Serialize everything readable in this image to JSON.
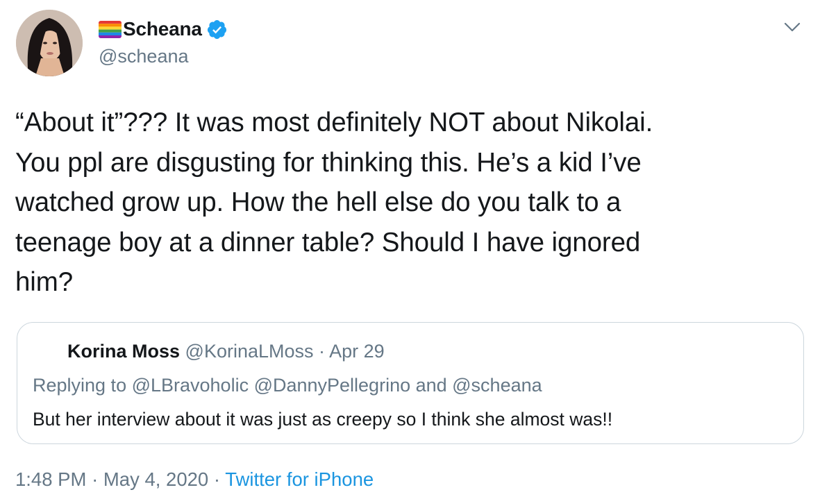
{
  "user": {
    "display_name": "Scheana",
    "handle": "@scheana",
    "flag_icon": "rainbow-flag-icon",
    "verified_icon": "verified-badge-icon"
  },
  "tweet": {
    "text": "“About it”??? It was most definitely NOT about Nikolai.\nYou ppl are disgusting for thinking this. He’s a kid I’ve\nwatched grow up. How the hell else do you talk to a\nteenage boy at a dinner table? Should I have ignored\nhim?"
  },
  "quote": {
    "name": "Korina Moss",
    "handle": "@KorinaLMoss",
    "separator": "·",
    "date": "Apr 29",
    "replying_to": "Replying to @LBravoholic @DannyPellegrino and @scheana",
    "body": "But her interview about it was just as creepy so I think she almost was!!"
  },
  "meta": {
    "time": "1:48 PM",
    "separator1": "·",
    "date": "May 4, 2020",
    "separator2": "·",
    "source": "Twitter for iPhone"
  },
  "colors": {
    "text": "#14171a",
    "secondary": "#657786",
    "link": "#1b95e0",
    "verified": "#1da1f2",
    "border": "#ccd6dd"
  },
  "icons": {
    "caret": "chevron-down-icon"
  }
}
